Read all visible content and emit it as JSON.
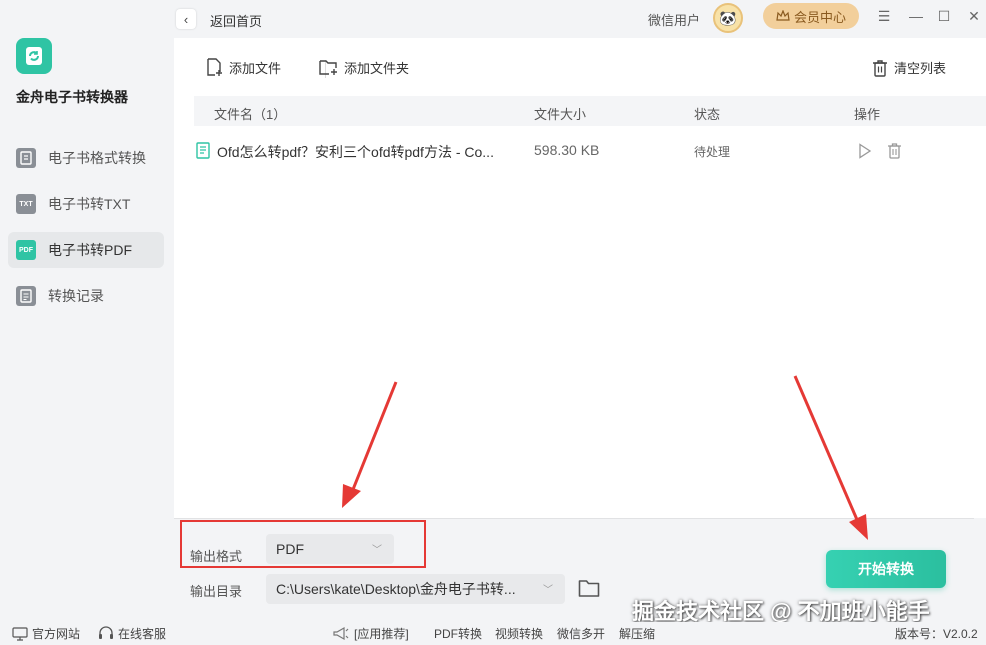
{
  "sidebar": {
    "app_name": "金舟电子书转换器",
    "items": [
      {
        "label": "电子书格式转换",
        "icon": "book-convert-icon",
        "active": false
      },
      {
        "label": "电子书转TXT",
        "icon": "txt-icon",
        "badge": "TXT",
        "active": false
      },
      {
        "label": "电子书转PDF",
        "icon": "pdf-icon",
        "badge": "PDF",
        "active": true
      },
      {
        "label": "转换记录",
        "icon": "history-icon",
        "active": false
      }
    ]
  },
  "topbar": {
    "back_label": "返回首页",
    "user_name": "微信用户",
    "vip_label": "会员中心"
  },
  "toolbar": {
    "add_file": "添加文件",
    "add_folder": "添加文件夹",
    "clear_list": "清空列表"
  },
  "table": {
    "headers": {
      "name": "文件名（1）",
      "size": "文件大小",
      "status": "状态",
      "action": "操作"
    },
    "rows": [
      {
        "name": "Ofd怎么转pdf？安利三个ofd转pdf方法 - Co...",
        "size": "598.30 KB",
        "status": "待处理"
      }
    ]
  },
  "output": {
    "format_label": "输出格式",
    "format_value": "PDF",
    "dir_label": "输出目录",
    "dir_value": "C:\\Users\\kate\\Desktop\\金舟电子书转..."
  },
  "start_button": "开始转换",
  "watermark": "掘金技术社区 @ 不加班小能手",
  "statusbar": {
    "website": "官方网站",
    "support": "在线客服",
    "recommend": "[应用推荐]",
    "links": [
      "PDF转换",
      "视频转换",
      "微信多开",
      "解压缩"
    ],
    "version": "版本号：V2.0.2"
  },
  "colors": {
    "accent": "#2fc4a4",
    "highlight_box": "#e53935",
    "vip": "#f2cf9b"
  }
}
